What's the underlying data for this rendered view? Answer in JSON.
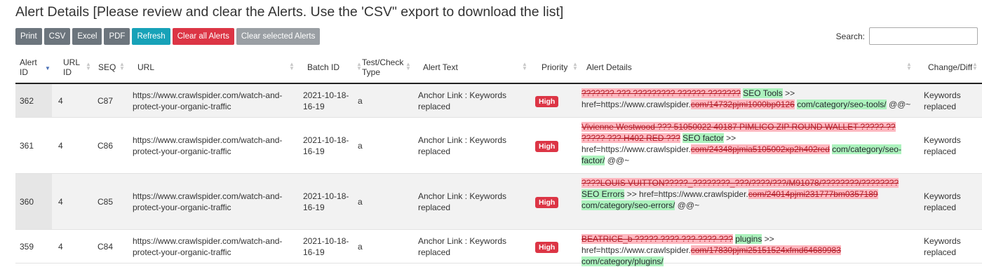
{
  "page": {
    "title": "Alert Details [Please review and clear the Alerts. Use the 'CSV\" export to download the list]"
  },
  "toolbar": {
    "print": "Print",
    "csv": "CSV",
    "excel": "Excel",
    "pdf": "PDF",
    "refresh": "Refresh",
    "clear_all": "Clear all Alerts",
    "clear_selected": "Clear selected Alerts"
  },
  "search": {
    "label": "Search:",
    "value": "",
    "placeholder": ""
  },
  "table": {
    "columns": [
      "Alert ID",
      "URL ID",
      "SEQ",
      "URL",
      "Batch ID",
      "Test/Check Type",
      "Alert Text",
      "Priority",
      "Alert Details",
      "Change/Diff"
    ],
    "sorted_by": "Alert ID",
    "sort_direction": "descending",
    "rows": [
      {
        "alert_id": "362",
        "url_id": "4",
        "seq": "C87",
        "url": "https://www.crawlspider.com/watch-and-protect-your-organic-traffic",
        "batch_id": "2021-10-18-16-19",
        "type": "a",
        "alert_text": "Anchor Link : Keywords replaced",
        "priority": "High",
        "details": {
          "removed_text": "??????? ??? ????????? ?????? ???????",
          "added_text": "SEO Tools",
          "arrow": ">>",
          "href_prefix": "href=https://www.crawlspider.",
          "removed_href": "com/14732pjmi1000bp0126",
          "added_href": "com/category/seo-tools/",
          "suffix": "@@~"
        },
        "change": "Keywords replaced"
      },
      {
        "alert_id": "361",
        "url_id": "4",
        "seq": "C86",
        "url": "https://www.crawlspider.com/watch-and-protect-your-organic-traffic",
        "batch_id": "2021-10-18-16-19",
        "type": "a",
        "alert_text": "Anchor Link : Keywords replaced",
        "priority": "High",
        "details": {
          "removed_text": "Vivienne Westwood ??? 51050022 40187 PIMLICO ZIP ROUND WALLET ????? ?? ????? ??? H402 RED ???",
          "added_text": "SEO factor",
          "arrow": ">>",
          "href_prefix": "href=https://www.crawlspider.",
          "removed_href": "com/24348pjmia5105002xp2h402red",
          "added_href": "com/category/seo-factor/",
          "suffix": "@@~"
        },
        "change": "Keywords replaced"
      },
      {
        "alert_id": "360",
        "url_id": "4",
        "seq": "C85",
        "url": "https://www.crawlspider.com/watch-and-protect-your-organic-traffic",
        "batch_id": "2021-10-18-16-19",
        "type": "a",
        "alert_text": "Anchor Link : Keywords replaced",
        "priority": "High",
        "details": {
          "removed_text": "????LOUIS VUITTON?????_????????_???/????/???/M91078/????????/????????",
          "added_text": "SEO Errors",
          "arrow": ">>",
          "href_prefix": "href=https://www.crawlspider.",
          "removed_href": "com/24014pjmi231777bm0357189",
          "added_href": "com/category/seo-errors/",
          "suffix": "@@~"
        },
        "change": "Keywords replaced"
      },
      {
        "alert_id": "359",
        "url_id": "4",
        "seq": "C84",
        "url": "https://www.crawlspider.com/watch-and-protect-your-organic-traffic",
        "batch_id": "2021-10-18-16-19",
        "type": "a",
        "alert_text": "Anchor Link : Keywords replaced",
        "priority": "High",
        "details": {
          "removed_text": "BEATRICE_b ????? ???? ??? ???? ???",
          "added_text": "plugins",
          "arrow": ">>",
          "href_prefix": "href=https://www.crawlspider.",
          "removed_href": "com/17830pjmi25151524xfmd64689983",
          "added_href": "com/category/plugins/",
          "suffix": ""
        },
        "change": "Keywords replaced"
      }
    ]
  },
  "colors": {
    "btn_gray": "#6c757d",
    "btn_teal": "#17a2b8",
    "btn_red": "#dc3545",
    "btn_light": "#9a9fa4",
    "badge_high": "#dc3545",
    "diff_removed_bg": "#fdb8c0",
    "diff_added_bg": "#acf2bd",
    "sort_active": "#4a6fb5"
  }
}
